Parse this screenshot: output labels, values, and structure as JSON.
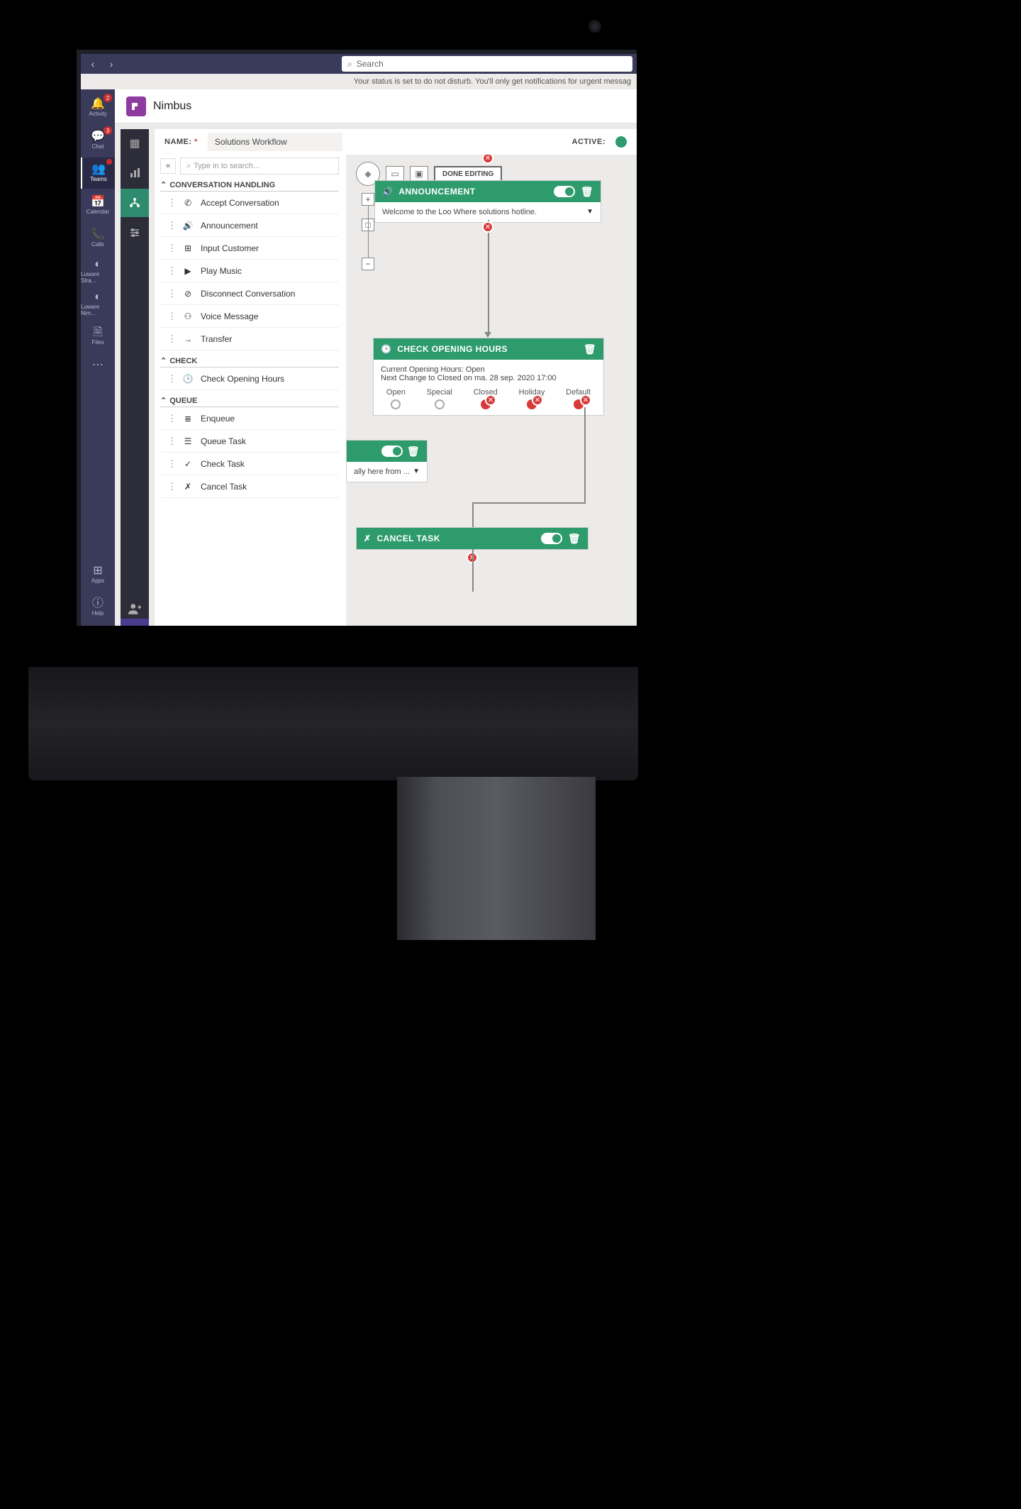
{
  "topbar": {
    "search_placeholder": "Search",
    "status_message": "Your status is set to do not disturb. You'll only get notifications for urgent messag"
  },
  "rail": {
    "activity": {
      "label": "Activity",
      "badge": "2"
    },
    "chat": {
      "label": "Chat",
      "badge": "3"
    },
    "teams": {
      "label": "Teams"
    },
    "calendar": {
      "label": "Calendar"
    },
    "calls": {
      "label": "Calls"
    },
    "luware_stra": {
      "label": "Luware Stra..."
    },
    "luware_nim": {
      "label": "Luware Nim..."
    },
    "files": {
      "label": "Files"
    },
    "apps": {
      "label": "Apps"
    },
    "help": {
      "label": "Help"
    }
  },
  "nimbus": {
    "title": "Nimbus"
  },
  "workflow": {
    "name_label": "NAME:",
    "name_value": "Solutions Workflow",
    "active_label": "ACTIVE:",
    "tree_search_placeholder": "Type in to search...",
    "done_editing": "DONE EDITING",
    "sections": {
      "conversation": {
        "title": "CONVERSATION HANDLING",
        "items": {
          "accept": "Accept Conversation",
          "announcement": "Announcement",
          "input_customer": "Input Customer",
          "play_music": "Play Music",
          "disconnect": "Disconnect Conversation",
          "voice_message": "Voice Message",
          "transfer": "Transfer"
        }
      },
      "check": {
        "title": "CHECK",
        "items": {
          "check_opening": "Check Opening Hours"
        }
      },
      "queue": {
        "title": "QUEUE",
        "items": {
          "enqueue": "Enqueue",
          "queue_task": "Queue Task",
          "check_task": "Check Task",
          "cancel_task": "Cancel Task"
        }
      }
    }
  },
  "nodes": {
    "announcement": {
      "title": "ANNOUNCEMENT",
      "body": "Welcome to the Loo Where solutions hotline."
    },
    "check_hours": {
      "title": "CHECK OPENING HOURS",
      "line1": "Current Opening Hours: Open",
      "line2": "Next Change to Closed on ma. 28 sep. 2020 17:00",
      "branches": {
        "open": "Open",
        "special": "Special",
        "closed": "Closed",
        "holiday": "Holiday",
        "default": "Default"
      }
    },
    "cancel_task": {
      "title": "CANCEL TASK"
    },
    "partial": {
      "body": "ally here from ..."
    }
  }
}
